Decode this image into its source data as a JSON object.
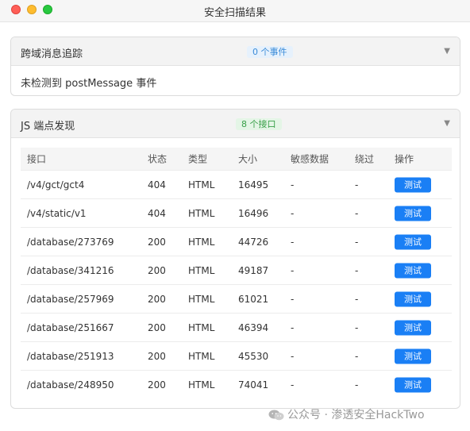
{
  "window": {
    "title": "安全扫描结果"
  },
  "panel_cross_origin": {
    "title": "跨域消息追踪",
    "badge": "0 个事件",
    "body_text": "未检测到 postMessage 事件"
  },
  "panel_endpoints": {
    "title": "JS 端点发现",
    "badge": "8 个接口",
    "columns": [
      "接口",
      "状态",
      "类型",
      "大小",
      "敏感数据",
      "绕过",
      "操作"
    ],
    "button_label": "测试",
    "rows": [
      {
        "api": "/v4/gct/gct4",
        "status": "404",
        "type": "HTML",
        "size": "16495",
        "sensitive": "-",
        "bypass": "-"
      },
      {
        "api": "/v4/static/v1",
        "status": "404",
        "type": "HTML",
        "size": "16496",
        "sensitive": "-",
        "bypass": "-"
      },
      {
        "api": "/database/273769",
        "status": "200",
        "type": "HTML",
        "size": "44726",
        "sensitive": "-",
        "bypass": "-"
      },
      {
        "api": "/database/341216",
        "status": "200",
        "type": "HTML",
        "size": "49187",
        "sensitive": "-",
        "bypass": "-"
      },
      {
        "api": "/database/257969",
        "status": "200",
        "type": "HTML",
        "size": "61021",
        "sensitive": "-",
        "bypass": "-"
      },
      {
        "api": "/database/251667",
        "status": "200",
        "type": "HTML",
        "size": "46394",
        "sensitive": "-",
        "bypass": "-"
      },
      {
        "api": "/database/251913",
        "status": "200",
        "type": "HTML",
        "size": "45530",
        "sensitive": "-",
        "bypass": "-"
      },
      {
        "api": "/database/248950",
        "status": "200",
        "type": "HTML",
        "size": "74041",
        "sensitive": "-",
        "bypass": "-"
      }
    ]
  },
  "watermark": {
    "text": "公众号 · 渗透安全HackTwo",
    "icon": "wechat-icon"
  },
  "colors": {
    "accent": "#1a7ff5",
    "badge_blue": "#3a8bd8",
    "badge_green": "#3aa04a"
  }
}
